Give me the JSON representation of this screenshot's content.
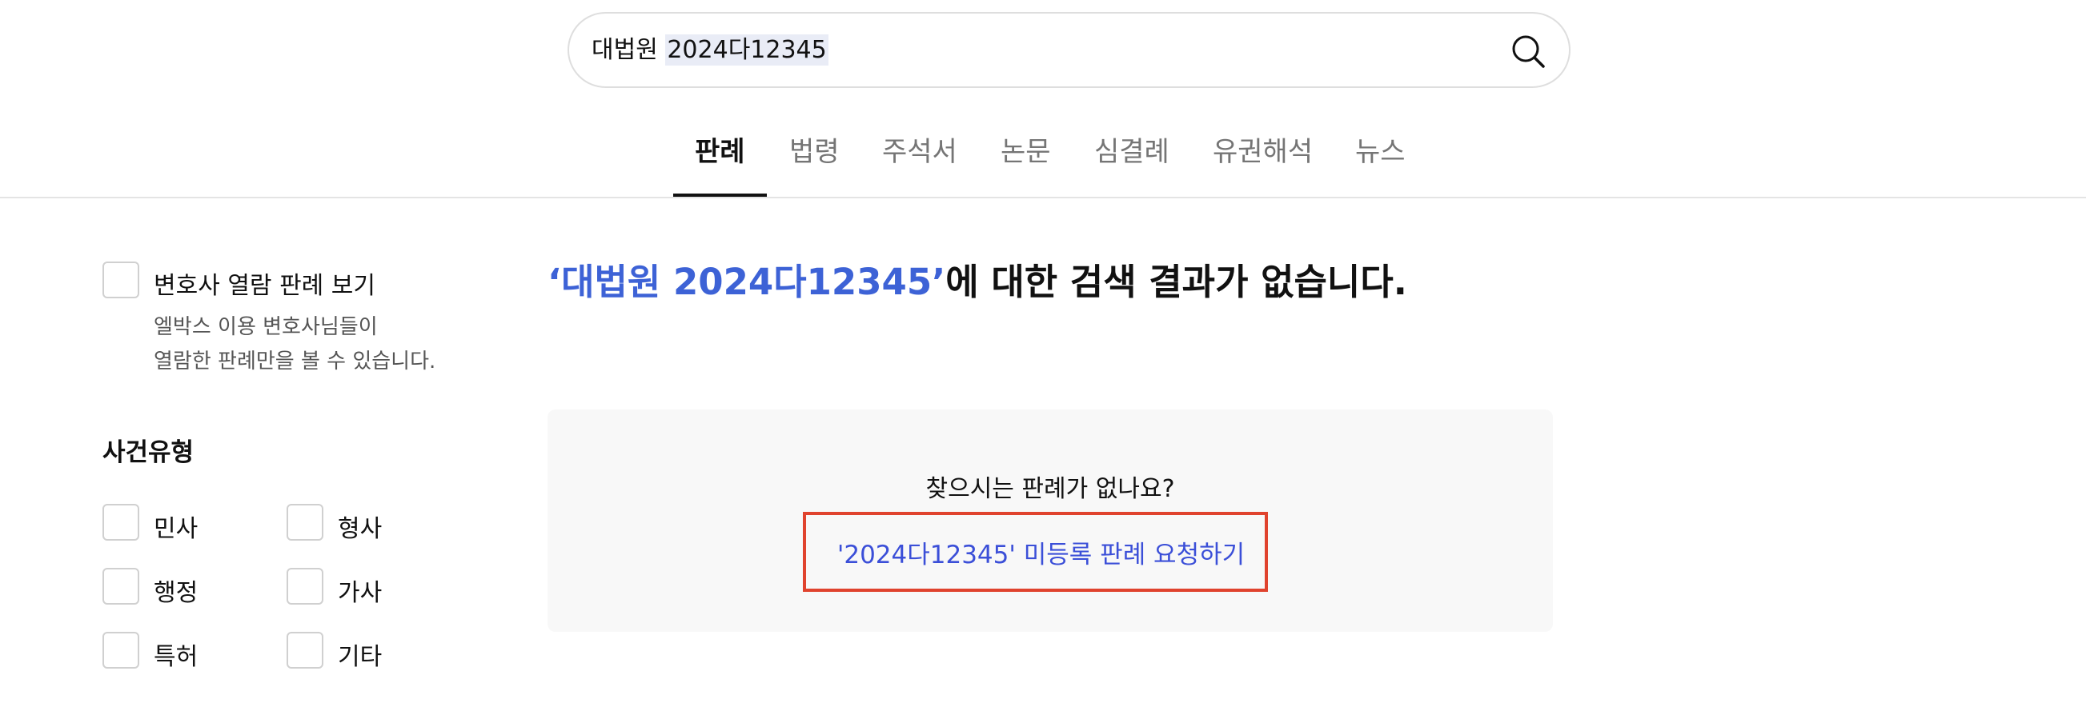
{
  "search": {
    "prefix": "대법원 ",
    "highlight": "2024다12345"
  },
  "tabs": [
    {
      "label": "판례",
      "active": true
    },
    {
      "label": "법령",
      "active": false
    },
    {
      "label": "주석서",
      "active": false
    },
    {
      "label": "논문",
      "active": false
    },
    {
      "label": "심결례",
      "active": false
    },
    {
      "label": "유권해석",
      "active": false
    },
    {
      "label": "뉴스",
      "active": false
    }
  ],
  "sidebar": {
    "lawyer_filter": {
      "label": "변호사 열람 판례 보기",
      "desc_line1": "엘박스 이용 변호사님들이",
      "desc_line2": "열람한 판례만을 볼 수 있습니다."
    },
    "case_type": {
      "title": "사건유형",
      "options": [
        "민사",
        "형사",
        "행정",
        "가사",
        "특허",
        "기타"
      ]
    }
  },
  "result": {
    "query_quoted": "‘대법원 2024다12345’",
    "suffix": "에 대한 검색 결과가 없습니다.",
    "empty_question": "찾으시는 판례가 없나요?",
    "request_button": "'2024다12345' 미등록 판례 요청하기"
  },
  "colors": {
    "accent": "#3d62d6",
    "button_text": "#3b4fd8",
    "highlight_border": "#e0432e",
    "empty_bg": "#f8f8f8"
  }
}
